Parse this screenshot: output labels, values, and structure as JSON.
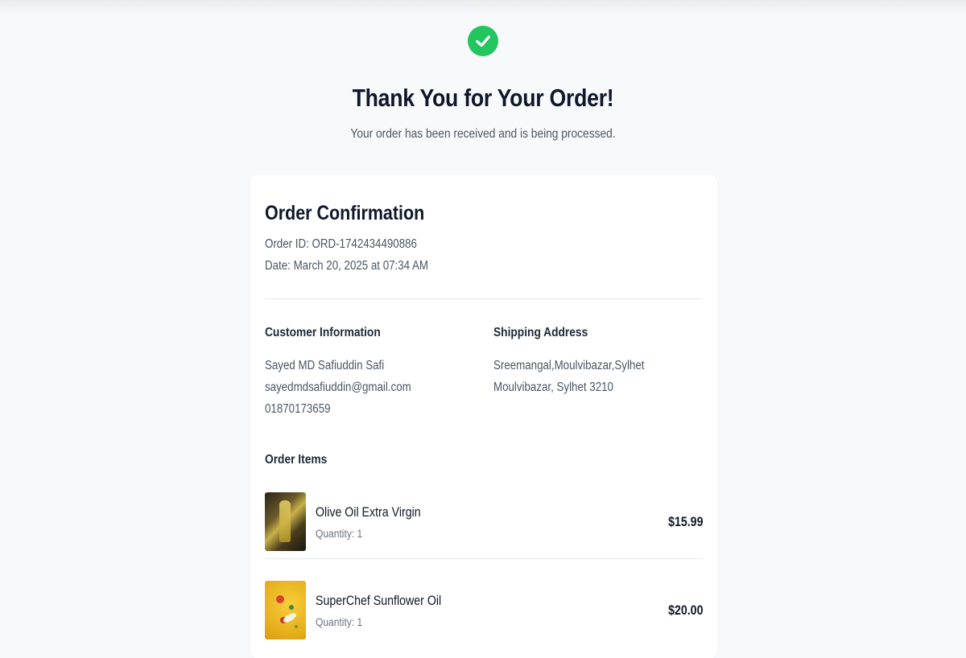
{
  "hero": {
    "icon": "check-circle-icon",
    "icon_color": "#22c55e",
    "title": "Thank You for Your Order!",
    "subtitle": "Your order has been received and is being processed."
  },
  "order": {
    "title": "Order Confirmation",
    "order_id": "Order ID: ORD-1742434490886",
    "date": "Date: March 20, 2025 at 07:34 AM"
  },
  "customer": {
    "heading": "Customer Information",
    "name": "Sayed MD Safiuddin Safi",
    "email": "sayedmdsafiuddin@gmail.com",
    "phone": "01870173659"
  },
  "shipping": {
    "heading": "Shipping Address",
    "line1": "Sreemangal,Moulvibazar,Sylhet",
    "line2": "Moulvibazar, Sylhet 3210"
  },
  "items_section": {
    "heading": "Order Items",
    "items": [
      {
        "name": "Olive Oil Extra Virgin",
        "quantity": "Quantity: 1",
        "price": "$15.99"
      },
      {
        "name": "SuperChef Sunflower Oil",
        "quantity": "Quantity: 1",
        "price": "$20.00"
      }
    ]
  }
}
